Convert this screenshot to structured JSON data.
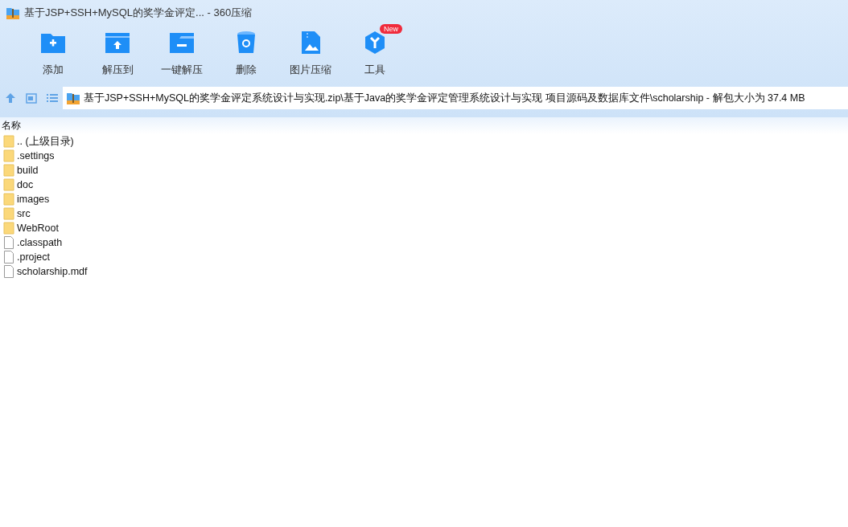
{
  "window": {
    "title": "基于JSP+SSH+MySQL的奖学金评定... - 360压缩"
  },
  "toolbar": [
    {
      "kind": "add",
      "label": "添加"
    },
    {
      "kind": "extract-to",
      "label": "解压到"
    },
    {
      "kind": "one-click",
      "label": "一键解压"
    },
    {
      "kind": "delete",
      "label": "删除"
    },
    {
      "kind": "image",
      "label": "图片压缩"
    },
    {
      "kind": "tools",
      "label": "工具",
      "badge": "New"
    }
  ],
  "address_bar": {
    "path": "基于JSP+SSH+MySQL的奖学金评定系统设计与实现.zip\\基于Java的奖学金评定管理系统设计与实现 项目源码及数据库文件\\scholarship - 解包大小为 37.4 MB"
  },
  "file_list": {
    "columns": [
      "名称"
    ],
    "rows": [
      {
        "kind": "folder",
        "name": ".. (上级目录)"
      },
      {
        "kind": "folder",
        "name": ".settings"
      },
      {
        "kind": "folder",
        "name": "build"
      },
      {
        "kind": "folder",
        "name": "doc"
      },
      {
        "kind": "folder",
        "name": "images"
      },
      {
        "kind": "folder",
        "name": "src"
      },
      {
        "kind": "folder",
        "name": "WebRoot"
      },
      {
        "kind": "file",
        "name": ".classpath"
      },
      {
        "kind": "file",
        "name": ".project"
      },
      {
        "kind": "file",
        "name": "scholarship.mdf"
      }
    ]
  }
}
